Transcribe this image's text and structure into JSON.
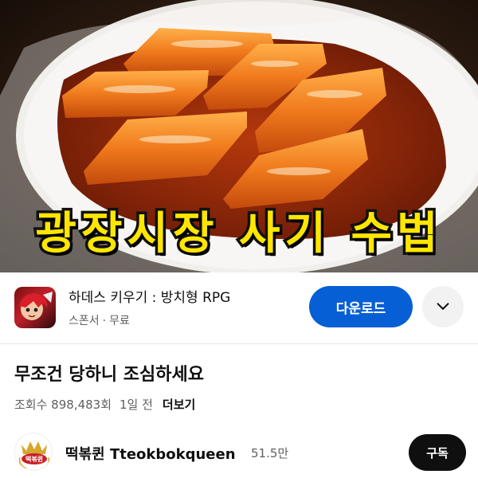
{
  "thumbnail": {
    "overlay_text": "광장시장 사기 수법"
  },
  "ad": {
    "app_name": "하데스 키우기 : 방치형 RPG",
    "sponsor_label": "스폰서",
    "separator": "·",
    "price_label": "무료",
    "download_label": "다운로드",
    "expand_icon": "chevron-down-icon"
  },
  "video": {
    "title": "무조건 당하니 조심하세요",
    "views": "조회수 898,483회",
    "age": "1일 전",
    "more_label": "더보기"
  },
  "channel": {
    "name": "떡볶퀸 Tteokbokqueen",
    "subscribers": "51.5만",
    "subscribe_label": "구독",
    "avatar_text": "떡볶퀸"
  },
  "colors": {
    "accent_blue": "#065fd4",
    "overlay_yellow": "#ffe600",
    "subscribe_black": "#0f0f0f"
  }
}
